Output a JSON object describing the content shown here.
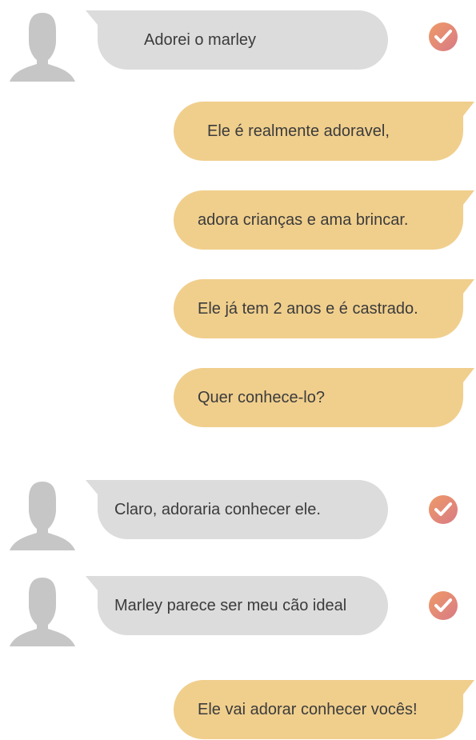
{
  "colors": {
    "incoming_bubble": "#dcdcdc",
    "outgoing_bubble": "#f0cf8d",
    "avatar": "#c6c6c6",
    "check_badge": "#e28f82",
    "text": "#3b3b3b"
  },
  "messages": [
    {
      "direction": "incoming",
      "text": "Adorei o marley",
      "status_icon": "read-check-icon"
    },
    {
      "direction": "outgoing",
      "text": "Ele é realmente adoravel,"
    },
    {
      "direction": "outgoing",
      "text": "adora crianças  e ama brincar."
    },
    {
      "direction": "outgoing",
      "text": "Ele já tem 2 anos e é castrado."
    },
    {
      "direction": "outgoing",
      "text": "Quer conhece-lo?"
    },
    {
      "direction": "incoming",
      "text": "Claro, adoraria conhecer ele.",
      "status_icon": "read-check-icon"
    },
    {
      "direction": "incoming",
      "text": "Marley parece ser meu cão ideal",
      "status_icon": "read-check-icon"
    },
    {
      "direction": "outgoing",
      "text": "Ele vai adorar conhecer vocês!"
    }
  ]
}
